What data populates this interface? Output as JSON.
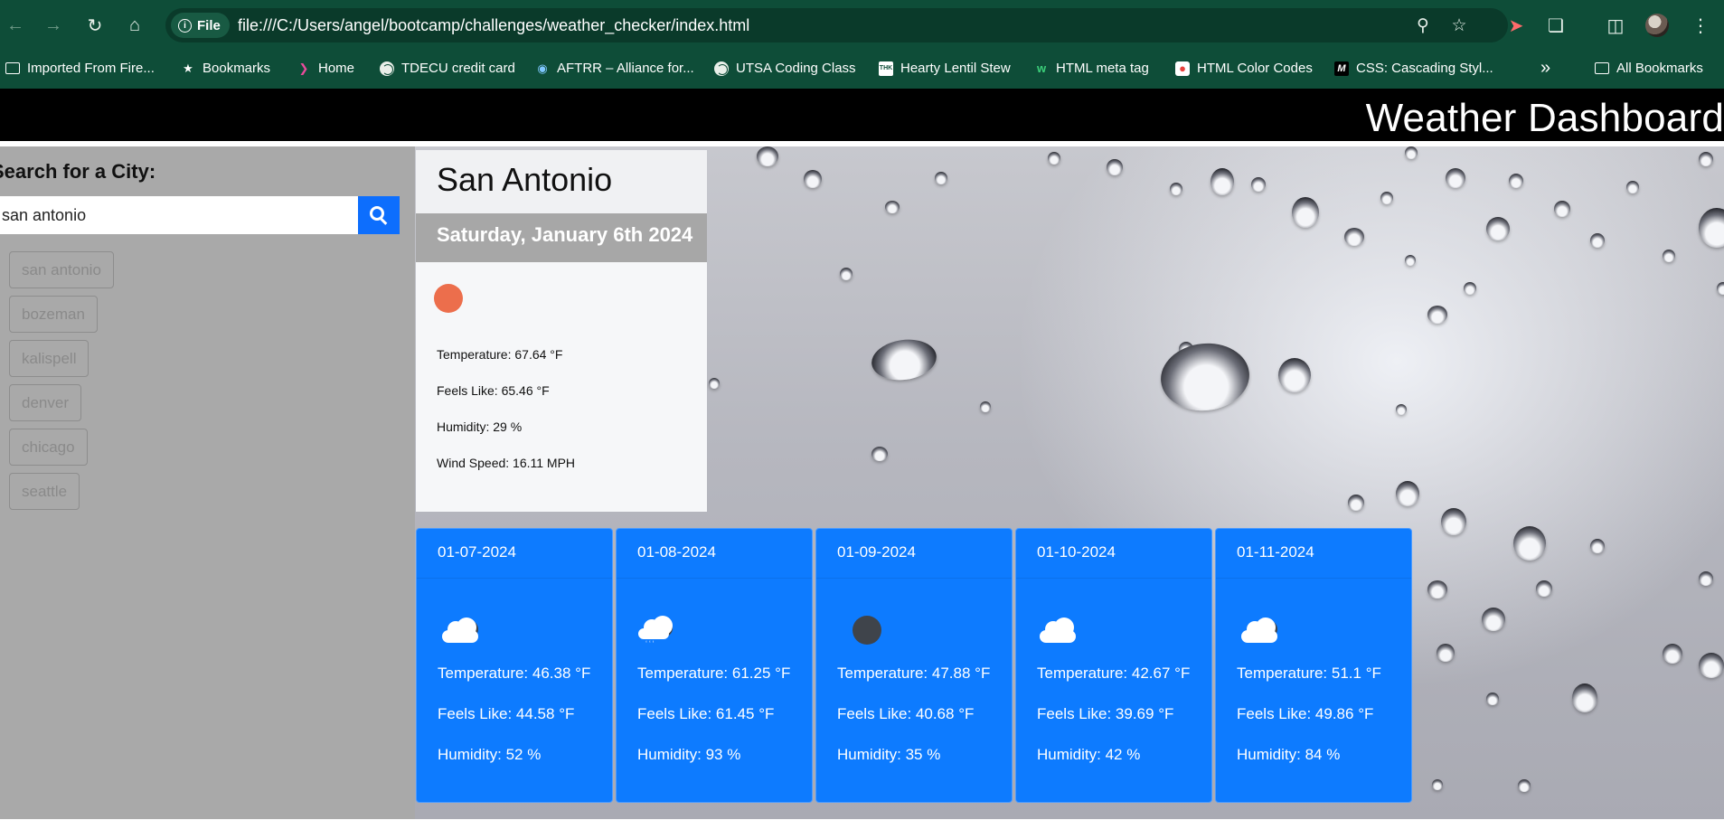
{
  "browser": {
    "url": "file:///C:/Users/angel/bootcamp/challenges/weather_checker/index.html",
    "site_chip": "File",
    "bookmarks": [
      {
        "label": "Imported From Fire...",
        "icon": "folder-icon"
      },
      {
        "label": "Bookmarks",
        "icon": "star-icon"
      },
      {
        "label": "Home",
        "icon": "brand-icon"
      },
      {
        "label": "TDECU credit card",
        "icon": "globe-icon"
      },
      {
        "label": "AFTRR – Alliance for...",
        "icon": "logo-icon"
      },
      {
        "label": "UTSA Coding Class",
        "icon": "globe-icon"
      },
      {
        "label": "Hearty Lentil Stew",
        "icon": "thk-icon"
      },
      {
        "label": "HTML meta tag",
        "icon": "w-icon"
      },
      {
        "label": "HTML Color Codes",
        "icon": "colorwheel-icon"
      },
      {
        "label": "CSS: Cascading Styl...",
        "icon": "mdn-icon"
      }
    ],
    "thk_glyph": "THK",
    "mdn_glyph": "M",
    "all_bookmarks": "All Bookmarks",
    "colors": {
      "chrome": "#0e4d38"
    }
  },
  "page": {
    "title": "Weather Dashboard",
    "search": {
      "label": "Search for a City:",
      "value": "san antonio"
    },
    "history": [
      "san antonio",
      "bozeman",
      "kalispell",
      "denver",
      "chicago",
      "seattle"
    ],
    "current": {
      "city": "San Antonio",
      "date": "Saturday, January 6th 2024",
      "icon": "sun-icon",
      "temperature": "Temperature: 67.64 °F",
      "feels_like": "Feels Like: 65.46 °F",
      "humidity": "Humidity: 29 %",
      "wind_speed": "Wind Speed: 16.11 MPH"
    },
    "forecast": [
      {
        "date": "01-07-2024",
        "icon": "partly-cloudy-icon",
        "temperature": "Temperature: 46.38 °F",
        "feels_like": "Feels Like: 44.58 °F",
        "humidity": "Humidity: 52 %"
      },
      {
        "date": "01-08-2024",
        "icon": "rain-cloud-icon",
        "temperature": "Temperature: 61.25 °F",
        "feels_like": "Feels Like: 61.45 °F",
        "humidity": "Humidity: 93 %"
      },
      {
        "date": "01-09-2024",
        "icon": "dark-cloud-icon",
        "temperature": "Temperature: 47.88 °F",
        "feels_like": "Feels Like: 40.68 °F",
        "humidity": "Humidity: 35 %"
      },
      {
        "date": "01-10-2024",
        "icon": "cloud-icon",
        "temperature": "Temperature: 42.67 °F",
        "feels_like": "Feels Like: 39.69 °F",
        "humidity": "Humidity: 42 %"
      },
      {
        "date": "01-11-2024",
        "icon": "partly-cloudy-icon",
        "temperature": "Temperature: 51.1 °F",
        "feels_like": "Feels Like: 49.86 °F",
        "humidity": "Humidity: 84 %"
      }
    ],
    "colors": {
      "forecast_bg": "#0d7bff",
      "search_button": "#0d6efd",
      "sidebar_bg": "#a9a9a9",
      "sun": "#ec6e4c"
    }
  }
}
